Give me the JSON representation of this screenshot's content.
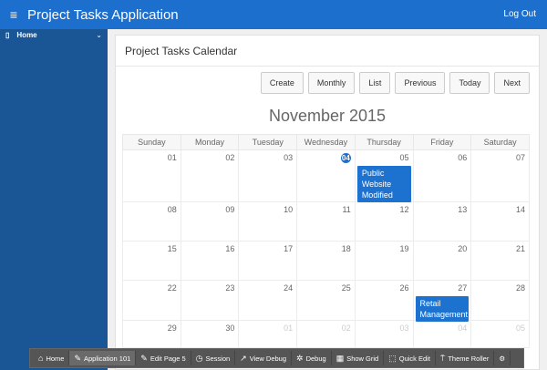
{
  "header": {
    "title": "Project Tasks Application",
    "logout": "Log Out",
    "menu_icon": "hamburger-icon"
  },
  "sidebar": {
    "items": [
      {
        "label": "Home"
      }
    ]
  },
  "page": {
    "title": "Project Tasks Calendar",
    "month": "November 2015",
    "buttons": [
      "Create",
      "Monthly",
      "List",
      "Previous",
      "Today",
      "Next"
    ]
  },
  "calendar": {
    "days": [
      "Sunday",
      "Monday",
      "Tuesday",
      "Wednesday",
      "Thursday",
      "Friday",
      "Saturday"
    ],
    "weeks": [
      [
        "01",
        "02",
        "03",
        "04",
        "05",
        "06",
        "07"
      ],
      [
        "08",
        "09",
        "10",
        "11",
        "12",
        "13",
        "14"
      ],
      [
        "15",
        "16",
        "17",
        "18",
        "19",
        "20",
        "21"
      ],
      [
        "22",
        "23",
        "24",
        "25",
        "26",
        "27",
        "28"
      ],
      [
        "29",
        "30",
        "01",
        "02",
        "03",
        "04",
        "05"
      ]
    ],
    "today": "04",
    "events": [
      {
        "day": "05",
        "title": "Public Website Modified"
      },
      {
        "day": "27",
        "title": "Retail Management"
      }
    ]
  },
  "devbar": {
    "items": [
      "Home",
      "Application 101",
      "Edit Page 5",
      "Session",
      "View Debug",
      "Debug",
      "Show Grid",
      "Quick Edit",
      "Theme Roller"
    ]
  }
}
